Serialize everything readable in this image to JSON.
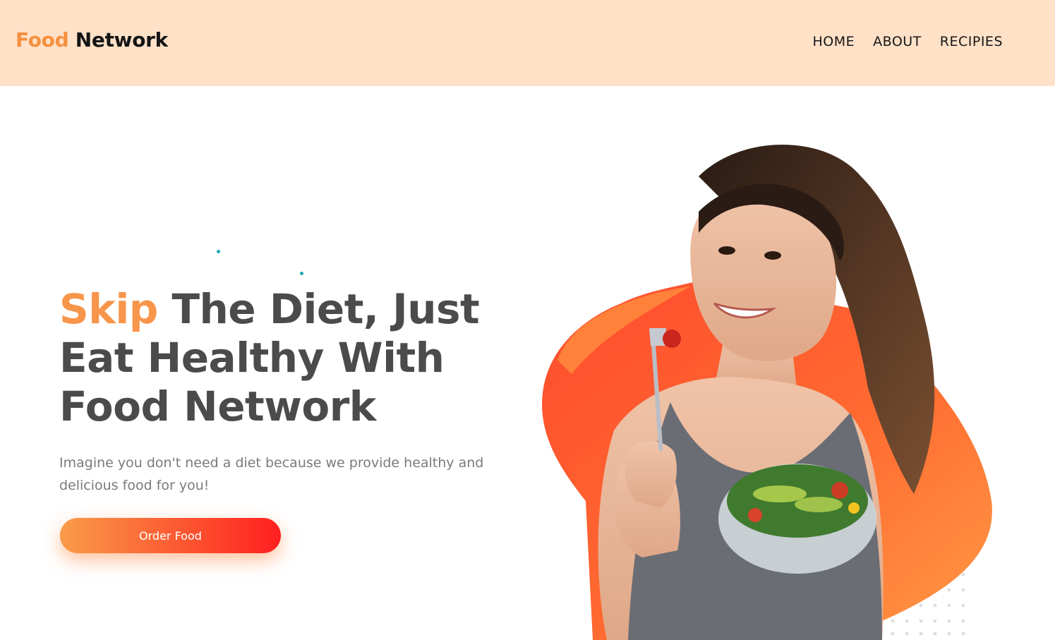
{
  "brand": {
    "accent": "Food",
    "rest": "Network"
  },
  "nav": {
    "items": [
      "HOME",
      "ABOUT",
      "RECIPIES"
    ]
  },
  "hero": {
    "title_accent": "Skip",
    "title_line1_rest": " The Diet, Just",
    "title_line2": "Eat Healthy With",
    "title_line3": "Food Network",
    "subtitle": "Imagine you don't need a diet because we provide healthy and delicious food for you!",
    "cta_label": "Order Food"
  },
  "colors": {
    "header_bg": "#ffe1c8",
    "accent_orange": "#f7954a",
    "heading_gray": "#4b4b4b",
    "cta_gradient_start": "#f99c48",
    "cta_gradient_end": "#ff1f1f"
  }
}
